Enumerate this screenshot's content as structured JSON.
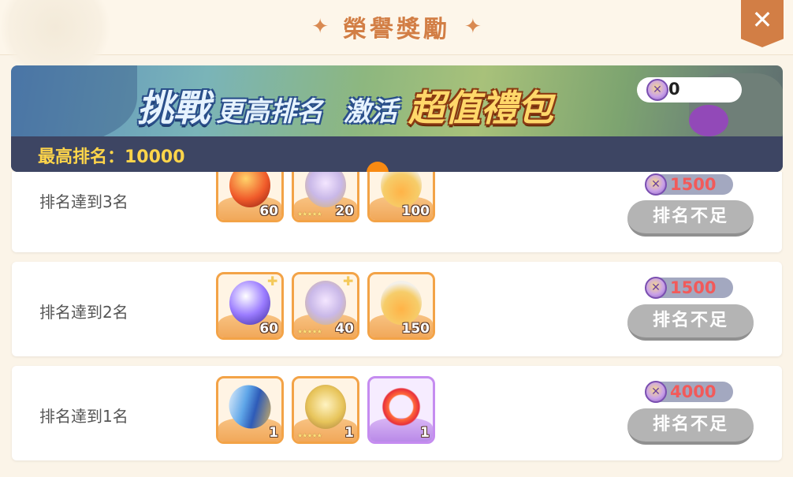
{
  "header": {
    "title": "榮譽獎勵",
    "sparkle_left": "✦",
    "sparkle_right": "✦",
    "close_label": "✕"
  },
  "banner": {
    "text_challenge": "挑戰",
    "text_higher_rank": "更高排名",
    "text_activate": "激活",
    "text_value_pack": "超值禮包",
    "best_rank_label": "最高排名：10000",
    "coin_count": "0"
  },
  "rewards": [
    {
      "label": "排名達到3名",
      "items": [
        {
          "icon": "red-orb-icon",
          "qty": "60",
          "stars": ""
        },
        {
          "icon": "crystal-mask-icon",
          "qty": "20",
          "stars": "★★★★★"
        },
        {
          "icon": "potion-bottle-icon",
          "qty": "100",
          "stars": ""
        }
      ],
      "price": "1500",
      "button": "排名不足"
    },
    {
      "label": "排名達到2名",
      "items": [
        {
          "icon": "purple-orb-icon",
          "qty": "60",
          "stars": ""
        },
        {
          "icon": "crystal-mask-icon",
          "qty": "40",
          "stars": "★★★★★"
        },
        {
          "icon": "potion-bottle-icon",
          "qty": "150",
          "stars": ""
        }
      ],
      "price": "1500",
      "button": "排名不足"
    },
    {
      "label": "排名達到1名",
      "items": [
        {
          "icon": "blue-sword-icon",
          "qty": "1",
          "stars": ""
        },
        {
          "icon": "golden-shield-icon",
          "qty": "1",
          "stars": "★★★★★"
        },
        {
          "icon": "fire-ring-icon",
          "qty": "1",
          "stars": ""
        }
      ],
      "price": "4000",
      "button": "排名不足"
    }
  ],
  "colors": {
    "accent": "#d27e45",
    "banner_bar": "#3d4563",
    "rank_highlight": "#ffd54a",
    "price_red": "#f25a5a",
    "disabled_button": "#b4b4b4"
  }
}
